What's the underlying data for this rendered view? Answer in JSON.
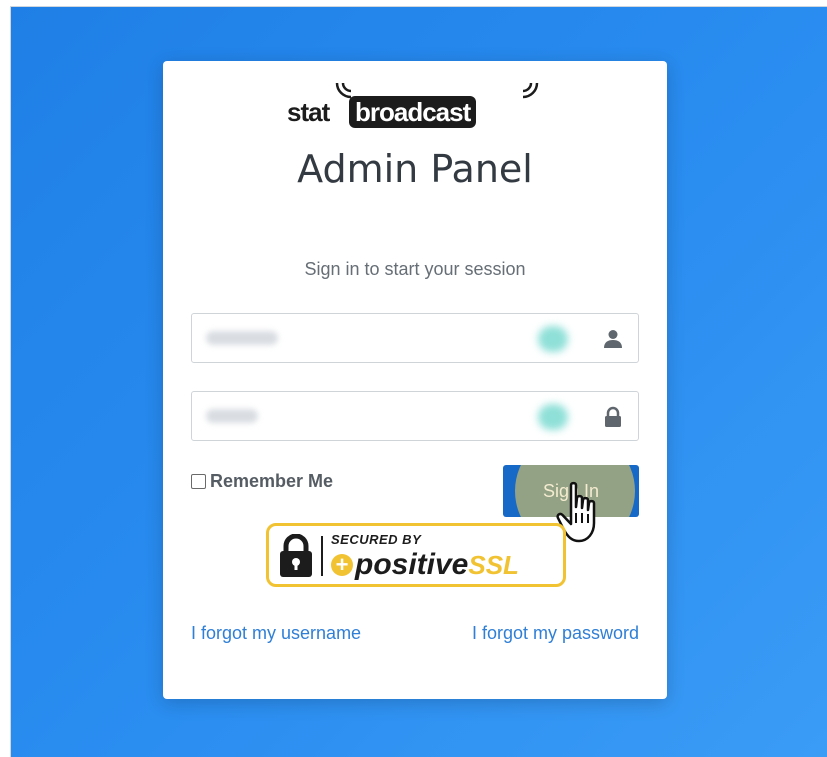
{
  "logo": {
    "part1": "stat",
    "part2": "broadcast"
  },
  "page_title": "Admin Panel",
  "subtitle": "Sign in to start your session",
  "username_field": {
    "icon": "user-icon"
  },
  "password_field": {
    "icon": "lock-icon"
  },
  "remember": {
    "label": "Remember Me",
    "checked": false
  },
  "signin_button": {
    "label": "Sign In"
  },
  "ssl_badge": {
    "secured_by": "SECURED BY",
    "brand_part1": "positive",
    "brand_part2": "SSL"
  },
  "links": {
    "forgot_username": "I forgot my username",
    "forgot_password": "I forgot my password"
  },
  "colors": {
    "background": "#1f7fe6",
    "button": "#1769c8",
    "link": "#2f7fd6",
    "ssl_accent": "#f1c232",
    "highlight": "#e0c45c"
  }
}
